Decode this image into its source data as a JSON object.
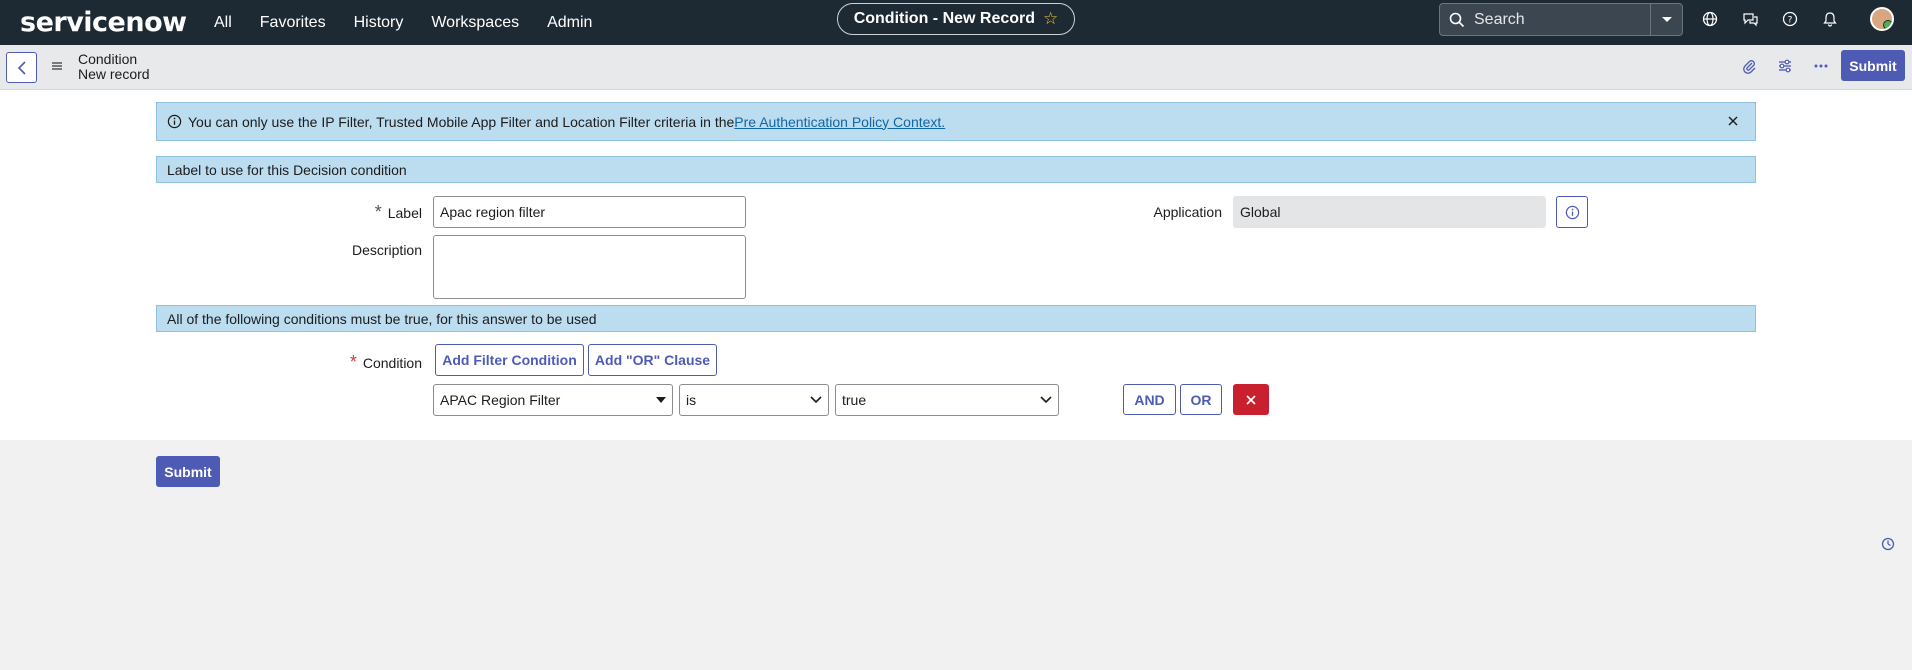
{
  "topnav": {
    "logo": "servicenow",
    "links": [
      "All",
      "Favorites",
      "History",
      "Workspaces",
      "Admin"
    ],
    "record_title": "Condition - New Record",
    "search_placeholder": "Search"
  },
  "subheader": {
    "table_name": "Condition",
    "record_label": "New record",
    "submit_label": "Submit"
  },
  "info_message": {
    "text": "You can only use the IP Filter, Trusted Mobile App Filter and Location Filter criteria in the ",
    "link_text": "Pre Authentication Policy Context."
  },
  "section1": {
    "title": "Label to use for this Decision condition"
  },
  "fields": {
    "label_label": "Label",
    "label_value": "Apac region filter",
    "description_label": "Description",
    "description_value": "",
    "application_label": "Application",
    "application_value": "Global"
  },
  "section2": {
    "title": "All of the following conditions must be true, for this answer to be used"
  },
  "condition": {
    "label": "Condition",
    "add_filter_label": "Add Filter Condition",
    "add_or_label": "Add \"OR\" Clause",
    "field_value": "APAC Region Filter",
    "operator_value": "is",
    "value_value": "true",
    "and_label": "AND",
    "or_label": "OR"
  },
  "footer": {
    "submit_label": "Submit"
  },
  "colors": {
    "nav_bg": "#1d2933",
    "accent": "#4e5bb5",
    "info_bg": "#bcdcef",
    "delete": "#c8202f"
  }
}
